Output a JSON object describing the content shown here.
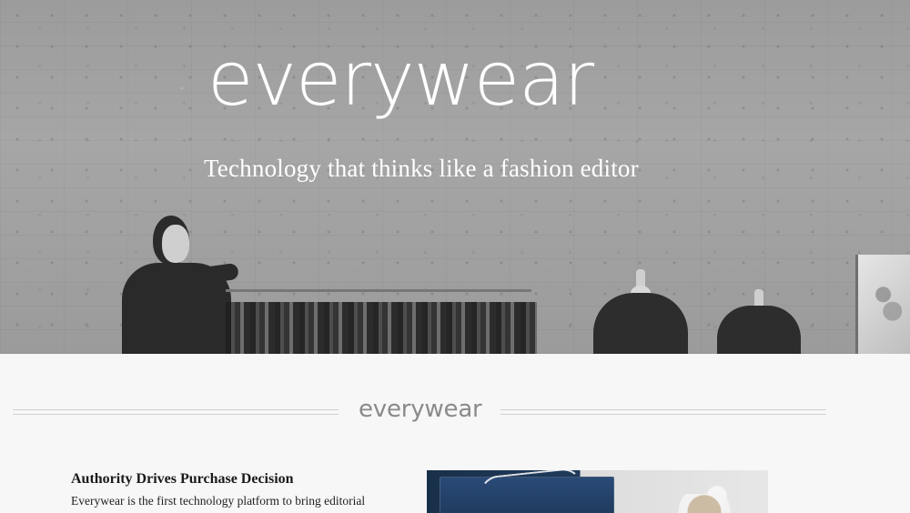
{
  "hero": {
    "logo_text": "everywear",
    "tagline": "Technology that thinks like a fashion editor"
  },
  "section": {
    "logo_text": "everywear",
    "feature": {
      "title": "Authority Drives Purchase Decision",
      "body": "Everywear is the first technology platform to bring editorial"
    }
  },
  "colors": {
    "background": "#f7f7f7",
    "hero_text": "#ffffff",
    "logo_gray": "#8a8a8a",
    "text_dark": "#1a1a1a"
  }
}
